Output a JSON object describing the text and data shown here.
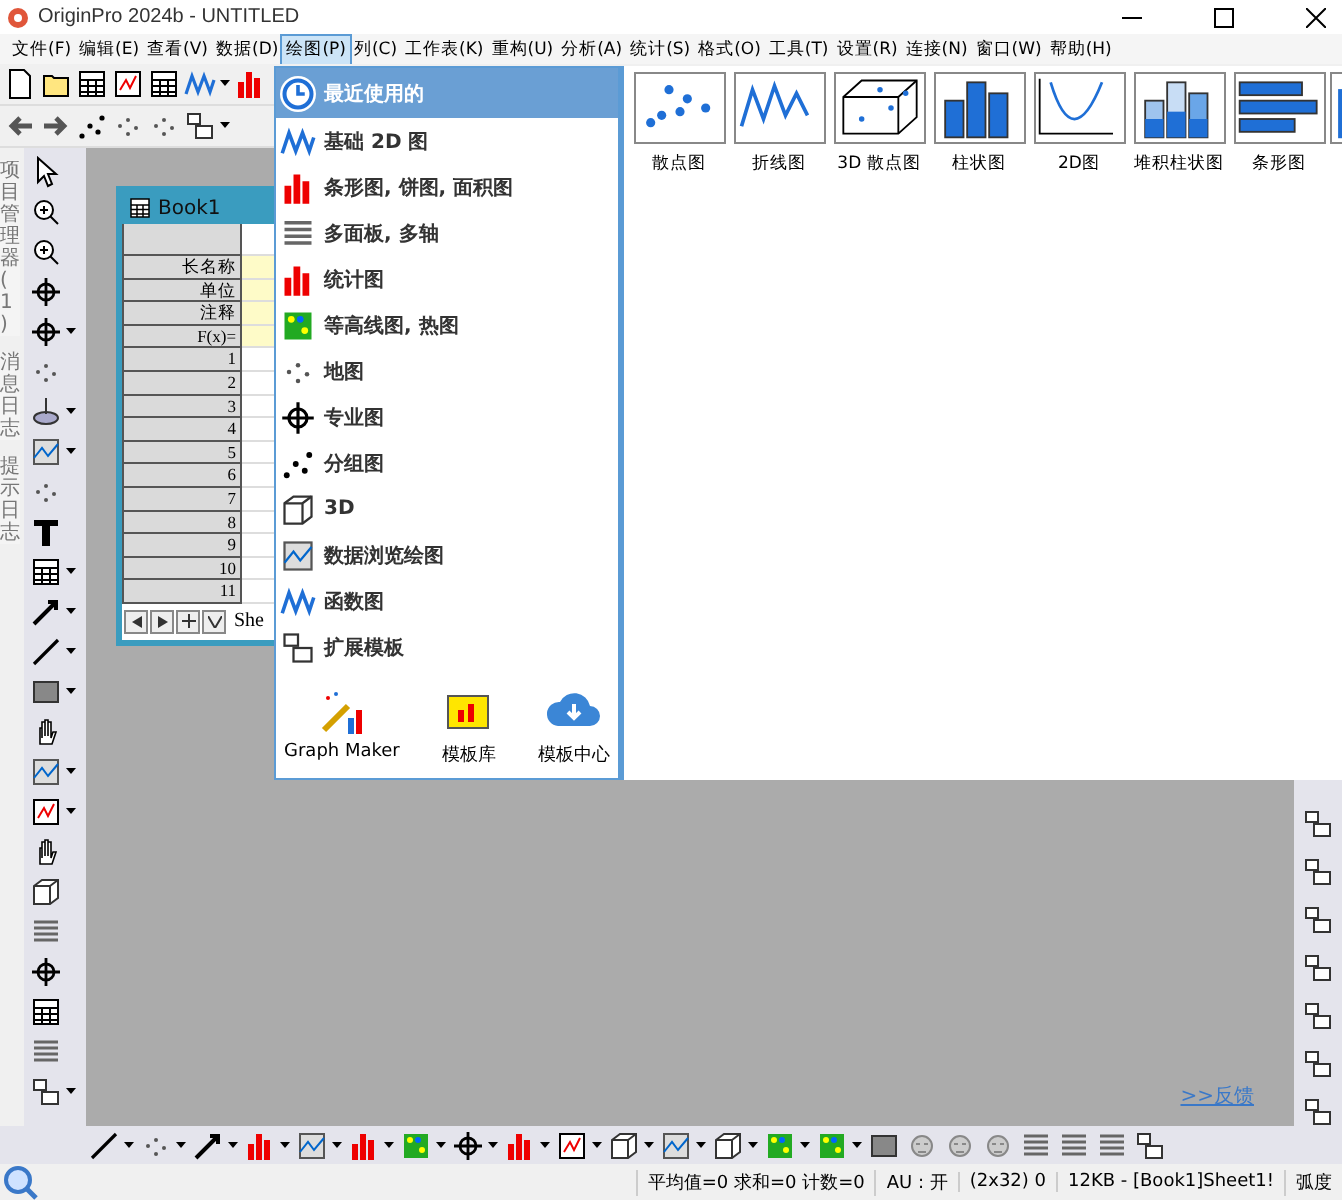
{
  "window": {
    "title": "OriginPro 2024b - UNTITLED"
  },
  "menu_bar": [
    {
      "label": "文件(F)",
      "selected": false
    },
    {
      "label": "编辑(E)",
      "selected": false
    },
    {
      "label": "查看(V)",
      "selected": false
    },
    {
      "label": "数据(D)",
      "selected": false
    },
    {
      "label": "绘图(P)",
      "selected": true
    },
    {
      "label": "列(C)",
      "selected": false
    },
    {
      "label": "工作表(K)",
      "selected": false
    },
    {
      "label": "重构(U)",
      "selected": false
    },
    {
      "label": "分析(A)",
      "selected": false
    },
    {
      "label": "统计(S)",
      "selected": false
    },
    {
      "label": "格式(O)",
      "selected": false
    },
    {
      "label": "工具(T)",
      "selected": false
    },
    {
      "label": "设置(R)",
      "selected": false
    },
    {
      "label": "连接(N)",
      "selected": false
    },
    {
      "label": "窗口(W)",
      "selected": false
    },
    {
      "label": "帮助(H)",
      "selected": false
    }
  ],
  "side_tabs": [
    "项目管理器 (1)",
    "消息日志",
    "提示日志"
  ],
  "workbook": {
    "title": "Book1",
    "row_labels": [
      "长名称",
      "单位",
      "注释",
      "F(x)="
    ],
    "row_numbers": [
      "1",
      "2",
      "3",
      "4",
      "5",
      "6",
      "7",
      "8",
      "9",
      "10",
      "11"
    ],
    "sheet_tab": "She"
  },
  "plot_menu": {
    "items": [
      {
        "label": "最近使用的",
        "selected": true
      },
      {
        "label": "基础 2D 图",
        "selected": false
      },
      {
        "label": "条形图, 饼图, 面积图",
        "selected": false
      },
      {
        "label": "多面板, 多轴",
        "selected": false
      },
      {
        "label": "统计图",
        "selected": false
      },
      {
        "label": "等高线图, 热图",
        "selected": false
      },
      {
        "label": "地图",
        "selected": false
      },
      {
        "label": "专业图",
        "selected": false
      },
      {
        "label": "分组图",
        "selected": false
      },
      {
        "label": "3D",
        "selected": false
      },
      {
        "label": "数据浏览绘图",
        "selected": false
      },
      {
        "label": "函数图",
        "selected": false
      },
      {
        "label": "扩展模板",
        "selected": false
      }
    ],
    "tools": [
      "Graph Maker",
      "模板库",
      "模板中心"
    ]
  },
  "gallery": {
    "items": [
      "散点图",
      "折线图",
      "3D 散点图",
      "柱状图",
      "2D图",
      "堆积柱状图",
      "条形图"
    ]
  },
  "feedback_link": ">>反馈",
  "status_bar": [
    "平均值=0 求和=0 计数=0",
    "AU : 开",
    "(2x32) 0",
    "12KB - [Book1]Sheet1!",
    "弧度"
  ]
}
